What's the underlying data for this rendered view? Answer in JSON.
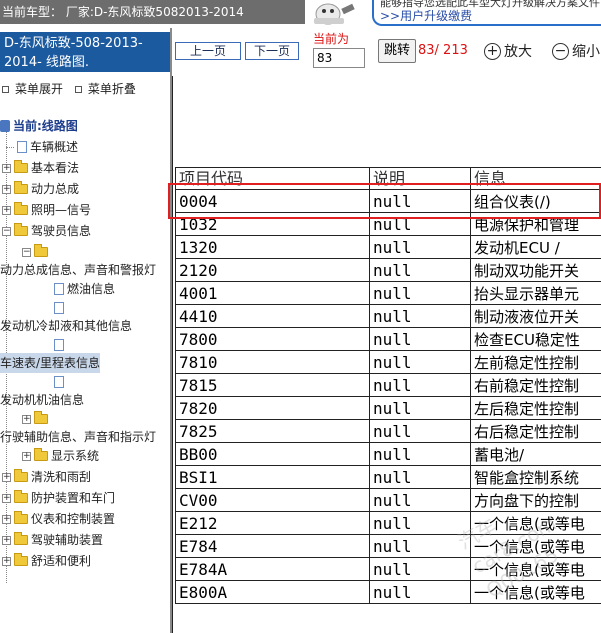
{
  "banner": {
    "left_text": "当前车型：  厂家:D-东风标致5082013-2014",
    "promo_line1": "能够指导您选配此车型大灯升级解决方案文件",
    "promo_line2": ">>用户升级缴费"
  },
  "left": {
    "car_title": "D-东风标致-508-2013-2014- 线路图.",
    "expand_label": "菜单展开",
    "collapse_label": "菜单折叠",
    "tree": {
      "current_label": "当前:线路图",
      "items": [
        {
          "label": "车辆概述"
        },
        {
          "label": "基本看法"
        },
        {
          "label": "动力总成"
        },
        {
          "label": "照明—信号"
        },
        {
          "label": "驾驶员信息"
        },
        {
          "label": "动力总成信息、声音和警报灯"
        },
        {
          "label": "燃油信息"
        },
        {
          "label": "发动机冷却液和其他信息"
        },
        {
          "label": "车速表/里程表信息"
        },
        {
          "label": "发动机机油信息"
        },
        {
          "label": "行驶辅助信息、声音和指示灯"
        },
        {
          "label": "显示系统"
        },
        {
          "label": "清洗和雨刮"
        },
        {
          "label": "防护装置和车门"
        },
        {
          "label": "仪表和控制装置"
        },
        {
          "label": "驾驶辅助装置"
        },
        {
          "label": "舒适和便利"
        }
      ]
    }
  },
  "toolbar": {
    "prev_label": "上一页",
    "next_label": "下一页",
    "current_label": "当前为",
    "page_value": "83",
    "jump_label": "跳转",
    "page_count": "83/ 213",
    "zoom_in_label": "放大",
    "zoom_out_label": "缩小"
  },
  "table": {
    "headers": [
      "项目代码",
      "说明",
      "信息"
    ],
    "rows": [
      [
        "0004",
        "null",
        "组合仪表(/)"
      ],
      [
        "1032",
        "null",
        "电源保护和管理"
      ],
      [
        "1320",
        "null",
        "发动机ECU /"
      ],
      [
        "2120",
        "null",
        "制动双功能开关"
      ],
      [
        "4001",
        "null",
        "抬头显示器单元"
      ],
      [
        "4410",
        "null",
        "制动液液位开关"
      ],
      [
        "7800",
        "null",
        "检查ECU稳定性"
      ],
      [
        "7810",
        "null",
        "左前稳定性控制"
      ],
      [
        "7815",
        "null",
        "右前稳定性控制"
      ],
      [
        "7820",
        "null",
        "左后稳定性控制"
      ],
      [
        "7825",
        "null",
        "右后稳定性控制"
      ],
      [
        "BB00",
        "null",
        "蓄电池/"
      ],
      [
        "BSI1",
        "null",
        "智能盒控制系统"
      ],
      [
        "CV00",
        "null",
        "方向盘下的控制"
      ],
      [
        "E212",
        "null",
        "一个信息(或等电"
      ],
      [
        "E784",
        "null",
        "一个信息(或等电"
      ],
      [
        "E784A",
        "null",
        "一个信息(或等电"
      ],
      [
        "E800A",
        "null",
        "一个信息(或等电"
      ]
    ]
  },
  "watermark": {
    "line1": "汽车",
    "line2": "car8.com",
    "line3": "Q00165"
  },
  "colors": {
    "title_bg": "#1c5aa0",
    "highlight": "#e02020",
    "accent_red": "#dd1111",
    "banner_bg": "#6d6d6d"
  }
}
